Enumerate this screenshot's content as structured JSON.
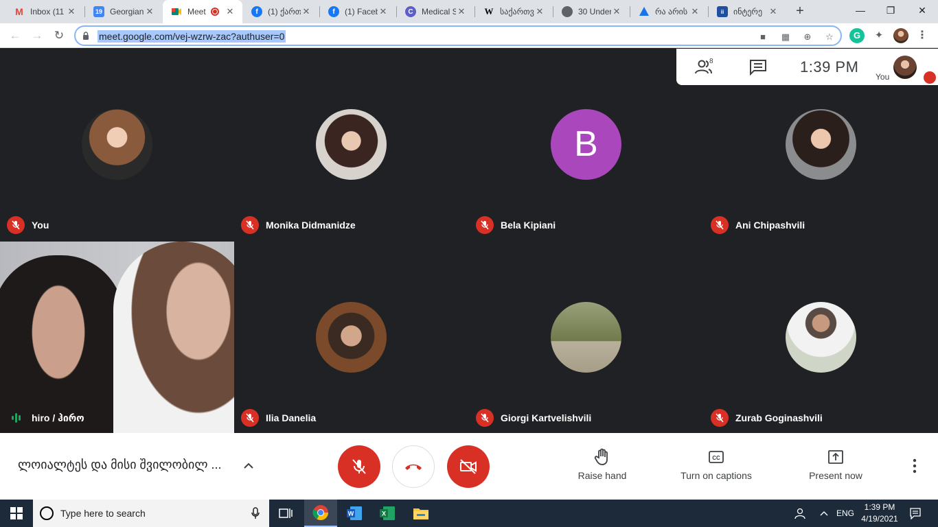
{
  "browser": {
    "tabs": [
      {
        "title": "Inbox (11",
        "favicon": "gmail-icon",
        "color": "#ea4335",
        "glyph": "M"
      },
      {
        "title": "Georgian",
        "favicon": "calendar-icon",
        "color": "#4285f4",
        "glyph": "19"
      },
      {
        "title": "Meet",
        "favicon": "meet-icon",
        "color": "#00897b",
        "glyph": "",
        "active": true
      },
      {
        "title": "(1) ქართ",
        "favicon": "facebook-icon",
        "color": "#1877f2",
        "glyph": "f"
      },
      {
        "title": "(1) Faceb",
        "favicon": "facebook-icon",
        "color": "#1877f2",
        "glyph": "f"
      },
      {
        "title": "Medical S",
        "favicon": "c-icon",
        "color": "#5b5fc7",
        "glyph": "C"
      },
      {
        "title": "საქართვ",
        "favicon": "wikipedia-icon",
        "color": "#ffffff",
        "glyph": "W"
      },
      {
        "title": "30 Under",
        "favicon": "globe-icon",
        "color": "#5f6368",
        "glyph": ""
      },
      {
        "title": "რა არის",
        "favicon": "triangle-icon",
        "color": "#1a73e8",
        "glyph": ""
      },
      {
        "title": "ინტერე",
        "favicon": "site-icon",
        "color": "#1e4fa3",
        "glyph": "ii"
      }
    ],
    "url": "meet.google.com/vej-wzrw-zac?authuser=0"
  },
  "meet": {
    "participant_count": "8",
    "clock": "1:39  PM",
    "you_label": "You",
    "participants": [
      {
        "name": "You",
        "avatar": "photo",
        "mic": "off"
      },
      {
        "name": "Monika Didmanidze",
        "avatar": "photo",
        "mic": "off"
      },
      {
        "name": "Bela Kipiani",
        "avatar": "letter",
        "letter": "B",
        "mic": "off"
      },
      {
        "name": "Ani Chipashvili",
        "avatar": "photo",
        "mic": "off"
      },
      {
        "name": "hiro / ჰირო",
        "avatar": "video",
        "mic": "speaking"
      },
      {
        "name": "Ilia Danelia",
        "avatar": "photo",
        "mic": "off"
      },
      {
        "name": "Giorgi Kartvelishvili",
        "avatar": "photo",
        "mic": "off"
      },
      {
        "name": "Zurab Goginashvili",
        "avatar": "photo",
        "mic": "off"
      }
    ],
    "controls": {
      "meeting_title": "ლოიალტეს და მისი შვილობილ ...",
      "raise_hand": "Raise hand",
      "captions": "Turn on captions",
      "present": "Present now"
    }
  },
  "taskbar": {
    "search_placeholder": "Type here to search",
    "lang": "ENG",
    "time": "1:39 PM",
    "date": "4/19/2021"
  }
}
